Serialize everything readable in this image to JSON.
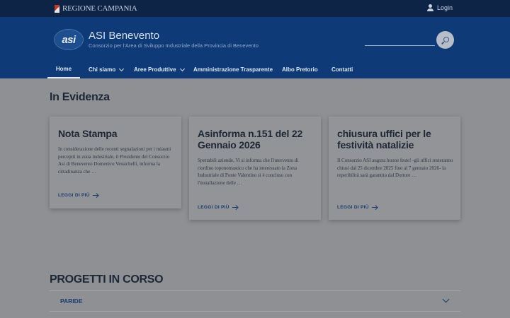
{
  "topbar": {
    "region_label": "REGIONE CAMPANIA",
    "login_label": "Login"
  },
  "header": {
    "logo_text": "asi",
    "title": "ASI Benevento",
    "subtitle": "Consorzio per l'Area di Sviluppo Industriale della Provincia di Benevento",
    "search_icon": "search-icon"
  },
  "nav": {
    "items": [
      {
        "label": "Home",
        "active": true,
        "dropdown": false
      },
      {
        "label": "Chi siamo",
        "active": false,
        "dropdown": true
      },
      {
        "label": "Aree Produttive",
        "active": false,
        "dropdown": true
      },
      {
        "label": "Amministrazione Trasparente",
        "active": false,
        "dropdown": false
      },
      {
        "label": "Albo Pretorio",
        "active": false,
        "dropdown": false
      },
      {
        "label": "Contatti",
        "active": false,
        "dropdown": false
      }
    ]
  },
  "evidenza": {
    "title": "In Evidenza",
    "cards": [
      {
        "title": "Nota Stampa",
        "text": "In considerazione delle recenti segnalazioni per i miasmi percepiti in zona industriale, il Presidente del Consorzio Asi di Benevento Domenico Vessichelli, informa la cittadinanza che …",
        "link": "LEGGI DI PIÙ"
      },
      {
        "title": "Asinforma n.151 del 22 Gennaio 2026",
        "text": "Spettabili aziende, Vi si informa che l'intervento di riordino toponomastico che ha interessato la Zona Industriale di Ponte Valentino si è concluso con l'installazione delle …",
        "link": "LEGGI DI PIÙ"
      },
      {
        "title": "chiusura uffici per le festività natalizie",
        "text": "Il Consorzio ASI augura buone feste! -gli uffici resteranno chiusi dal 25 dicembre 2025 fino al 7 gennaio 2026- la reperibilità sarà garantita dal Dottore …",
        "link": "LEGGI DI PIÙ"
      }
    ]
  },
  "progetti": {
    "title": "PROGETTI IN CORSO",
    "items": [
      {
        "label": "PARIDE"
      }
    ]
  },
  "colors": {
    "slim_bg": "#0d2446",
    "header_bg": "#0e3a78",
    "page_bg_dimmed": "#8e9093",
    "link": "#1b3c70"
  }
}
